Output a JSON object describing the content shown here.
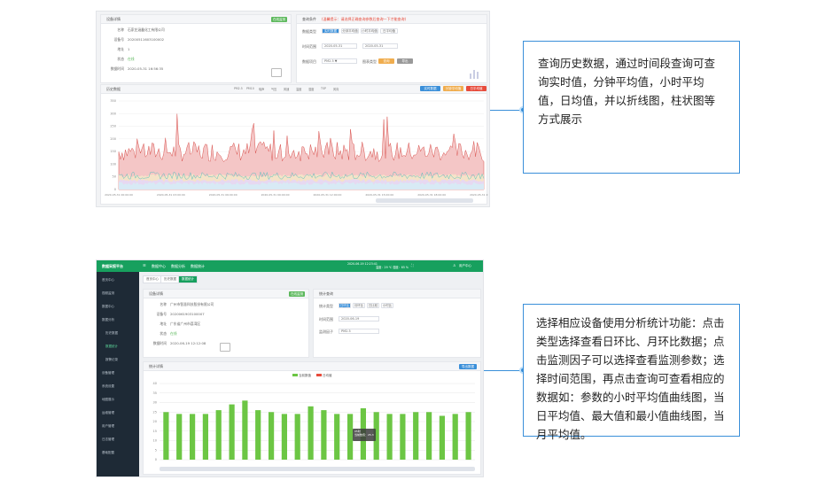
{
  "notes": {
    "top": "查询历史数据，通过时间段查询可查询实时值，分钟平均值，小时平均值，日均值，并以折线图，柱状图等方式展示",
    "bottom": "选择相应设备使用分析统计功能：点击类型选择查看日环比、月环比数据；点击监测因子可以选择查看监测参数；选择时间范围，再点击查询可查看相应的数据如：参数的小时平均值曲线图，当日平均值、最大值和最小值曲线图，当月平均值。"
  },
  "shot1": {
    "device_panel_title": "设备详情",
    "device_panel_badge": "在线监测",
    "rows": [
      {
        "k": "名称",
        "v": "石家庄涵鑫化工有限公司"
      },
      {
        "k": "设备号",
        "v": "20200511603100002"
      },
      {
        "k": "地址",
        "v": "1"
      },
      {
        "k": "状态",
        "v": "在线"
      },
      {
        "k": "数据时间",
        "v": "2020-05-31 16:56:35"
      }
    ],
    "query_panel_title": "查询条件",
    "query_panel_note": "(温馨提示：请选择正确查询参数后查询一下才能查询)",
    "data_type_label": "数据类型",
    "data_types": [
      "实时数据",
      "分钟平均值",
      "小时平均值",
      "日平均值"
    ],
    "time_label": "时间范围",
    "time_from": "2020-05-31",
    "time_to": "2020-05-31",
    "factor_label": "数据项目",
    "factor_value": "PM2.5 ▼",
    "chart_label": "图表类型",
    "query_btn": "查询",
    "export_btn": "导出",
    "chart_panel_title": "历史数据",
    "legend": [
      "PM2.5",
      "PM10",
      "噪声",
      "气压",
      "风速",
      "温度",
      "湿度",
      "TSP",
      "风向"
    ],
    "panel_btns": [
      "实时数据",
      "分钟平均值",
      "日平均值"
    ],
    "y_ticks": [
      "350",
      "300",
      "250",
      "200",
      "150",
      "100",
      "50",
      "0"
    ],
    "x_ticks": [
      "2020-05-31 00:00:00",
      "2020-05-31 03:00:00",
      "2020-05-31 06:00:00",
      "2020-05-31 09:00:00",
      "2020-05-31 12:00:00",
      "2020-05-31 15:00:00",
      "2020-05-31 18:00:00",
      "2020-05-31 21:00:00"
    ]
  },
  "shot2": {
    "brand": "数据采报平台",
    "breadcrumb": [
      "数据中心",
      "数据分析",
      "数据统计"
    ],
    "top_info": [
      "2020-06-19 12:23:41",
      "温度：29 ℃ 湿度：65 %"
    ],
    "user": "用户中心",
    "menu": [
      "首页中心",
      "视频监测",
      "数据中心",
      "数据分析",
      "历史数据",
      "数据统计",
      "报警记录",
      "设备管理",
      "系统设置",
      "地图展示",
      "运维管理",
      "用户管理",
      "日志管理",
      "基础配置"
    ],
    "tabs": [
      "首页中心",
      "历史数据",
      "数据统计"
    ],
    "device_panel_title": "设备详情",
    "device_panel_badge": "在线监测",
    "rows": [
      {
        "k": "名称",
        "v": "广州市智慧科技股份有限公司"
      },
      {
        "k": "设备号",
        "v": "2020061903100007"
      },
      {
        "k": "地址",
        "v": "广东省广州市荔湾区"
      },
      {
        "k": "状态",
        "v": "在线"
      },
      {
        "k": "数据时间",
        "v": "2020-06-19 12:12:08"
      }
    ],
    "query_panel_title": "统计查询",
    "stat_type_label": "统计类型",
    "stat_types": [
      "日环比",
      "月环比",
      "日比较",
      "小时比"
    ],
    "time_label": "时间范围",
    "time_value": "2020-06-19",
    "factor_label": "监测因子",
    "factor_value": "PM2.5",
    "chart_panel_title": "统计详情",
    "chart_btn": "导出数据",
    "legend": [
      "当前数值",
      "日均值"
    ],
    "tooltip_title": "05时",
    "tooltip_line": "当前数值：25.3"
  },
  "chart_data": {
    "type": "bar",
    "title": "统计详情",
    "series": [
      {
        "name": "当前数值",
        "values": [
          25,
          24,
          24,
          24,
          26,
          29,
          31,
          26,
          25,
          24,
          24,
          28,
          26,
          24,
          24,
          27,
          25,
          24,
          24,
          25,
          25,
          23,
          24,
          25
        ]
      }
    ],
    "ylim": [
      0,
      40
    ],
    "y_ticks": [
      "40",
      "35",
      "30",
      "25",
      "20",
      "15",
      "10",
      "5",
      "0"
    ],
    "grid": true,
    "legend_position": "top-center",
    "colors": {
      "bar": "#6cc644",
      "legend2": "#e74c3c"
    }
  },
  "colors": {
    "accent": "#3a8fd9",
    "brand_green": "#17a05e",
    "line_fill": "#f4c6c6",
    "line_stroke": "#d9534f"
  }
}
